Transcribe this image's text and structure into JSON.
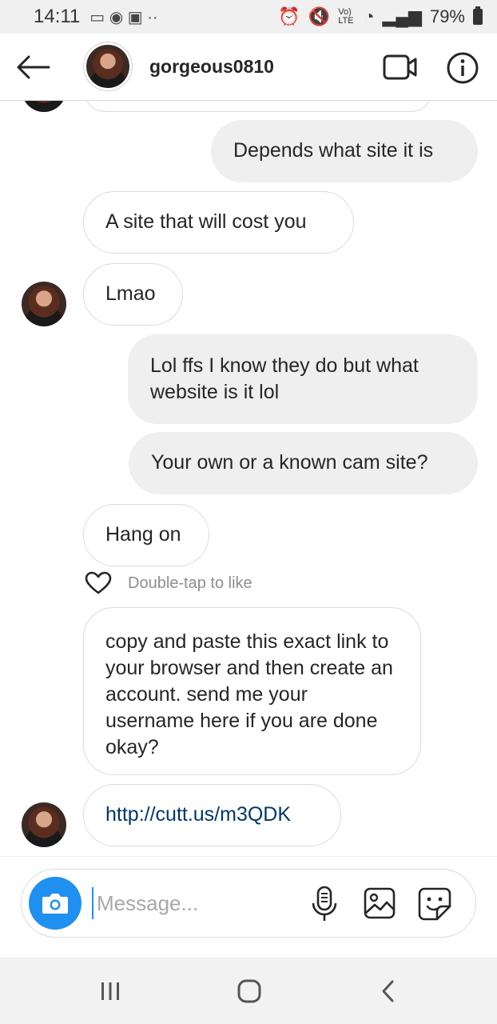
{
  "status_bar": {
    "time": "14:11",
    "battery": "79%",
    "network": "Vo) LTE"
  },
  "header": {
    "username": "gorgeous0810",
    "icons": [
      "back-arrow-icon",
      "video-call-icon",
      "info-icon"
    ]
  },
  "messages": [
    {
      "from": "them",
      "text": "Depends what site it is",
      "kind": "out"
    },
    {
      "from": "them",
      "text": "A site that will cost you"
    },
    {
      "from": "them",
      "text": "Lmao"
    },
    {
      "from": "me",
      "text": "Lol ffs I know they do but what website is it lol"
    },
    {
      "from": "me",
      "text": "Your own or a known cam site?"
    },
    {
      "from": "them",
      "text": "Hang on"
    },
    {
      "from": "them",
      "text": "copy and paste this exact link to your browser and then create an account. send me your username here if you are done okay?"
    },
    {
      "from": "them",
      "text": "http://cutt.us/m3QDK",
      "is_link": true
    }
  ],
  "like_hint": "Double-tap to like",
  "composer": {
    "placeholder": "Message...",
    "icons": [
      "camera-icon",
      "microphone-icon",
      "gallery-icon",
      "sticker-icon"
    ]
  },
  "colors": {
    "accent": "#1f8ff0",
    "link": "#00376b",
    "outgoing_bubble": "#efefef"
  }
}
